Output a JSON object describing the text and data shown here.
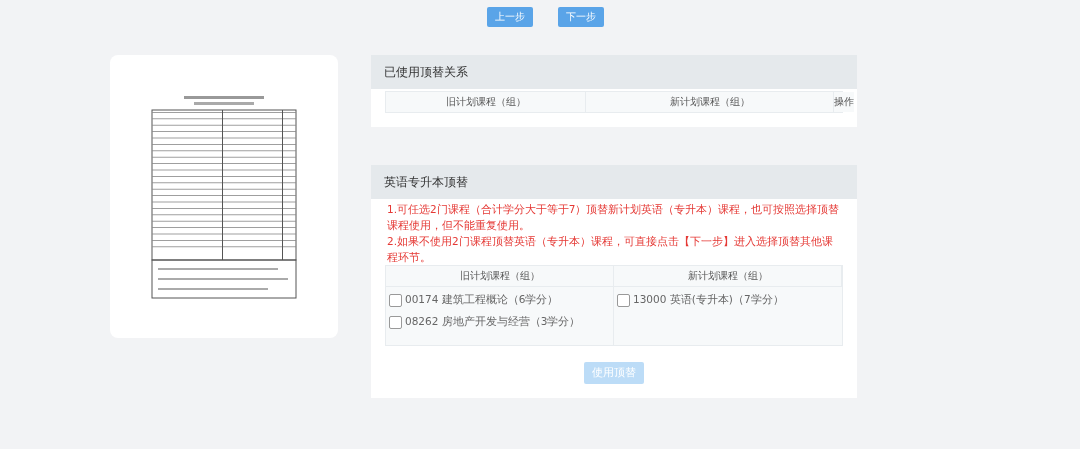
{
  "nav_buttons": [
    {
      "label": "上一步"
    },
    {
      "label": "下一步"
    }
  ],
  "used_panel": {
    "title": "已使用顶替关系",
    "columns": [
      "旧计划课程（组）",
      "新计划课程（组）",
      "操作"
    ]
  },
  "english_panel": {
    "title": "英语专升本顶替",
    "notes": [
      "1.可任选2门课程（合计学分大于等于7）顶替新计划英语（专升本）课程，也可按照选择顶替课程使用，但不能重复使用。",
      "2.如果不使用2门课程顶替英语（专升本）课程，可直接点击【下一步】进入选择顶替其他课程环节。"
    ],
    "columns": [
      "旧计划课程（组）",
      "新计划课程（组）"
    ],
    "old_courses": [
      {
        "label": "00174 建筑工程概论（6学分）",
        "checked": false
      },
      {
        "label": "08262 房地产开发与经营（3学分）",
        "checked": false
      }
    ],
    "new_courses": [
      {
        "label": "13000 英语(专升本)（7学分）",
        "checked": false
      }
    ],
    "submit": {
      "label": "使用顶替",
      "disabled": true
    }
  }
}
